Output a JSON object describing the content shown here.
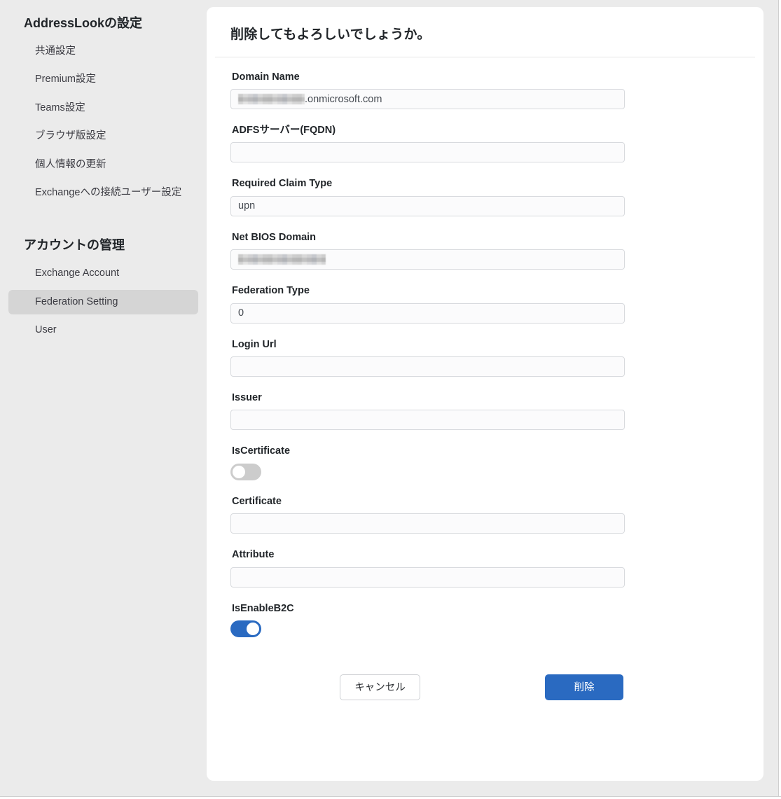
{
  "sidebar": {
    "groups": [
      {
        "heading": "AddressLookの設定",
        "items": [
          {
            "label": "共通設定",
            "active": false
          },
          {
            "label": "Premium設定",
            "active": false
          },
          {
            "label": "Teams設定",
            "active": false
          },
          {
            "label": "ブラウザ版設定",
            "active": false
          },
          {
            "label": "個人情報の更新",
            "active": false
          },
          {
            "label": "Exchangeへの接続ユーザー設定",
            "active": false
          }
        ]
      },
      {
        "heading": "アカウントの管理",
        "items": [
          {
            "label": "Exchange Account",
            "active": false
          },
          {
            "label": "Federation Setting",
            "active": true
          },
          {
            "label": "User",
            "active": false
          }
        ]
      }
    ]
  },
  "main": {
    "title": "削除してもよろしいでしょうか。",
    "fields": {
      "domain_name": {
        "label": "Domain Name",
        "value_suffix": ".onmicrosoft.com",
        "redacted": true
      },
      "adfs_server": {
        "label": "ADFSサーバー(FQDN)",
        "value": ""
      },
      "required_claim_type": {
        "label": "Required Claim Type",
        "value": "upn"
      },
      "net_bios_domain": {
        "label": "Net BIOS Domain",
        "value_suffix": "",
        "redacted": true
      },
      "federation_type": {
        "label": "Federation Type",
        "value": "0"
      },
      "login_url": {
        "label": "Login Url",
        "value": ""
      },
      "issuer": {
        "label": "Issuer",
        "value": ""
      },
      "is_certificate": {
        "label": "IsCertificate",
        "state": "off"
      },
      "certificate": {
        "label": "Certificate",
        "value": ""
      },
      "attribute": {
        "label": "Attribute",
        "value": ""
      },
      "is_enable_b2c": {
        "label": "IsEnableB2C",
        "state": "on"
      }
    },
    "actions": {
      "cancel_label": "キャンセル",
      "delete_label": "削除"
    }
  },
  "colors": {
    "accent_blue": "#2a6ac1",
    "page_bg": "#ebebeb",
    "card_bg": "#ffffff",
    "sidebar_active_bg": "#d5d5d5",
    "input_bg": "#fbfbfc"
  }
}
